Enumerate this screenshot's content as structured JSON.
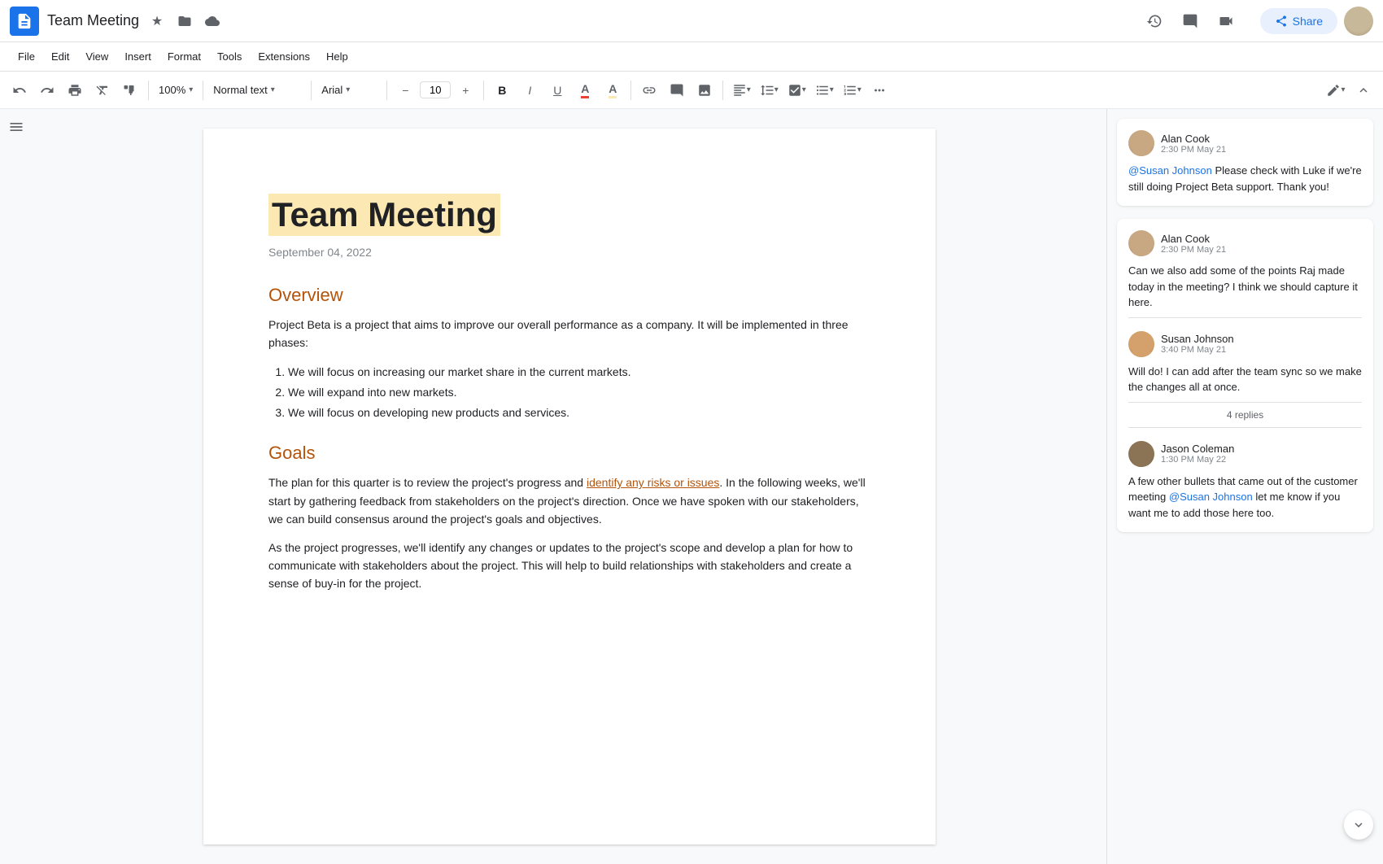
{
  "app": {
    "icon_label": "Google Docs",
    "doc_title": "Team Meeting",
    "star_icon": "★",
    "folder_icon": "🗂",
    "cloud_icon": "☁"
  },
  "header_right": {
    "history_icon": "🕐",
    "comment_icon": "💬",
    "video_icon": "📹",
    "share_label": "Share"
  },
  "menu": {
    "items": [
      "File",
      "Edit",
      "View",
      "Insert",
      "Format",
      "Tools",
      "Extensions",
      "Help"
    ]
  },
  "toolbar": {
    "undo": "↩",
    "redo": "↪",
    "print": "🖨",
    "clear_format": "T",
    "paint_format": "🖌",
    "zoom": "100%",
    "style": "Normal text",
    "font": "Arial",
    "font_size": "10",
    "bold": "B",
    "italic": "I",
    "underline": "U",
    "text_color": "A",
    "highlight": "A",
    "link": "🔗",
    "comment": "💬",
    "image": "🖼",
    "align": "≡",
    "line_spacing": "↕",
    "checklist": "☑",
    "bullet": "•",
    "numbered": "1.",
    "more": "⋯",
    "edit_mode": "✏",
    "collapse": "▲"
  },
  "document": {
    "title": "Team Meeting",
    "date": "September 04, 2022",
    "sections": [
      {
        "heading": "Overview",
        "paragraphs": [
          "Project Beta is a project that aims to improve our overall performance as a company. It will be implemented in three phases:"
        ],
        "list": [
          "We will focus on increasing our market share in the current markets.",
          "We will expand into new markets.",
          "We will focus on developing new products and services."
        ]
      },
      {
        "heading": "Goals",
        "paragraphs": [
          "The plan for this quarter is to review the project's progress and identify any risks or issues. In the following weeks, we'll start by gathering feedback from stakeholders on the project's direction. Once we have spoken with our stakeholders, we can build consensus around the project's goals and objectives.",
          "As the project progresses, we'll identify any changes or updates to the project's scope and develop a plan for how to communicate with stakeholders about the project. This will help to build relationships with stakeholders and create a sense of buy-in for the project."
        ]
      }
    ]
  },
  "comments": [
    {
      "id": "comment1",
      "author": "Alan Cook",
      "time": "2:30 PM May 21",
      "text": " Please check with Luke if we're still doing Project Beta support. Thank you!",
      "mention": "@Susan Johnson",
      "replies": []
    },
    {
      "id": "comment2",
      "author": "Alan Cook",
      "time": "2:30 PM May 21",
      "text": "Can we also add some of the points Raj made today in the meeting? I think we should capture it here.",
      "mention": "",
      "replies": [
        {
          "author": "Susan Johnson",
          "time": "3:40 PM May 21",
          "text": "Will do! I can add after the team sync so we make the changes all at once."
        }
      ],
      "replies_count": "4 replies",
      "sub_comment": {
        "author": "Jason Coleman",
        "time": "1:30 PM May 22",
        "text": "A few other bullets that came out of the customer meeting ",
        "mention": "@Susan Johnson",
        "text_after": " let me know if you want me to add those here too."
      }
    }
  ]
}
